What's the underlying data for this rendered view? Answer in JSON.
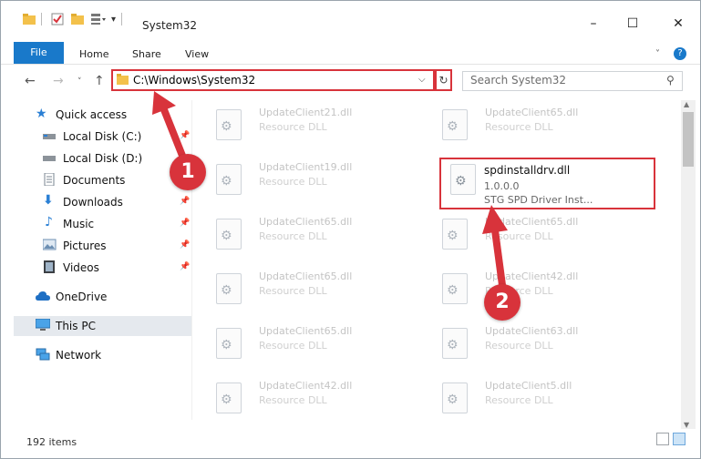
{
  "window": {
    "title": "System32",
    "tabs": {
      "file": "File",
      "home": "Home",
      "share": "Share",
      "view": "View"
    },
    "help": "?"
  },
  "address": {
    "path": "C:\\Windows\\System32",
    "search_placeholder": "Search System32"
  },
  "sidebar": {
    "items": [
      {
        "label": "Quick access",
        "icon": "star-icon"
      },
      {
        "label": "Local Disk (C:)",
        "icon": "drive-icon",
        "pinned": true
      },
      {
        "label": "Local Disk (D:)",
        "icon": "drive-icon"
      },
      {
        "label": "Documents",
        "icon": "documents-icon",
        "pinned": true
      },
      {
        "label": "Downloads",
        "icon": "download-icon",
        "pinned": true
      },
      {
        "label": "Music",
        "icon": "music-icon",
        "pinned": true
      },
      {
        "label": "Pictures",
        "icon": "pictures-icon",
        "pinned": true
      },
      {
        "label": "Videos",
        "icon": "videos-icon",
        "pinned": true
      },
      {
        "label": "OneDrive",
        "icon": "cloud-icon"
      },
      {
        "label": "This PC",
        "icon": "pc-icon",
        "selected": true
      },
      {
        "label": "Network",
        "icon": "network-icon"
      }
    ]
  },
  "files": {
    "left_column": [
      {
        "name": "UpdateClient21.dll",
        "type": "Resource DLL"
      },
      {
        "name": "UpdateClient19.dll",
        "type": "Resource DLL"
      },
      {
        "name": "UpdateClient65.dll",
        "type": "Resource DLL"
      },
      {
        "name": "UpdateClient65.dll",
        "type": "Resource DLL"
      },
      {
        "name": "UpdateClient65.dll",
        "type": "Resource DLL"
      },
      {
        "name": "UpdateClient42.dll",
        "type": "Resource DLL"
      }
    ],
    "right_column": [
      {
        "name": "UpdateClient65.dll",
        "type": "Resource DLL"
      },
      {
        "name": "spdinstalldrv.dll",
        "version": "1.0.0.0",
        "type": "STG SPD Driver Inst...",
        "highlighted": true
      },
      {
        "name": "UpdateClient65.dll",
        "type": "Resource DLL"
      },
      {
        "name": "UpdateClient42.dll",
        "type": "Resource DLL"
      },
      {
        "name": "UpdateClient63.dll",
        "type": "Resource DLL"
      },
      {
        "name": "UpdateClient5.dll",
        "type": "Resource DLL"
      }
    ]
  },
  "status": {
    "items": "192 items"
  },
  "annotations": {
    "badge1": "1",
    "badge2": "2",
    "color": "#d8333b"
  }
}
